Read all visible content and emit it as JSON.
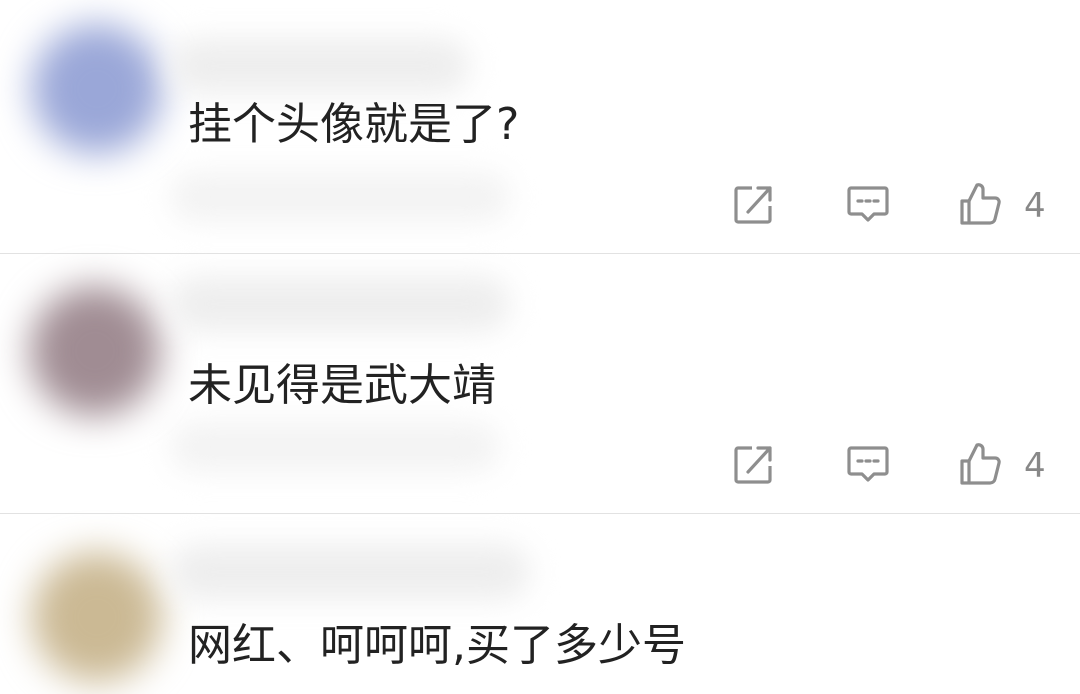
{
  "comments": [
    {
      "text": "挂个头像就是了?",
      "likes": "4"
    },
    {
      "text": "未见得是武大靖",
      "likes": "4"
    },
    {
      "text": "网红、呵呵呵,买了多少号"
    }
  ],
  "colors": {
    "text": "#222222",
    "icon": "#8e8e8e",
    "count": "#888888",
    "divider": "#e2e2e2",
    "avatar_1": "#9aa7d8",
    "avatar_2": "#a08c93",
    "avatar_3": "#cbb994"
  },
  "icons": {
    "share": "share-icon",
    "reply": "reply-icon",
    "like": "thumbs-up-icon"
  }
}
